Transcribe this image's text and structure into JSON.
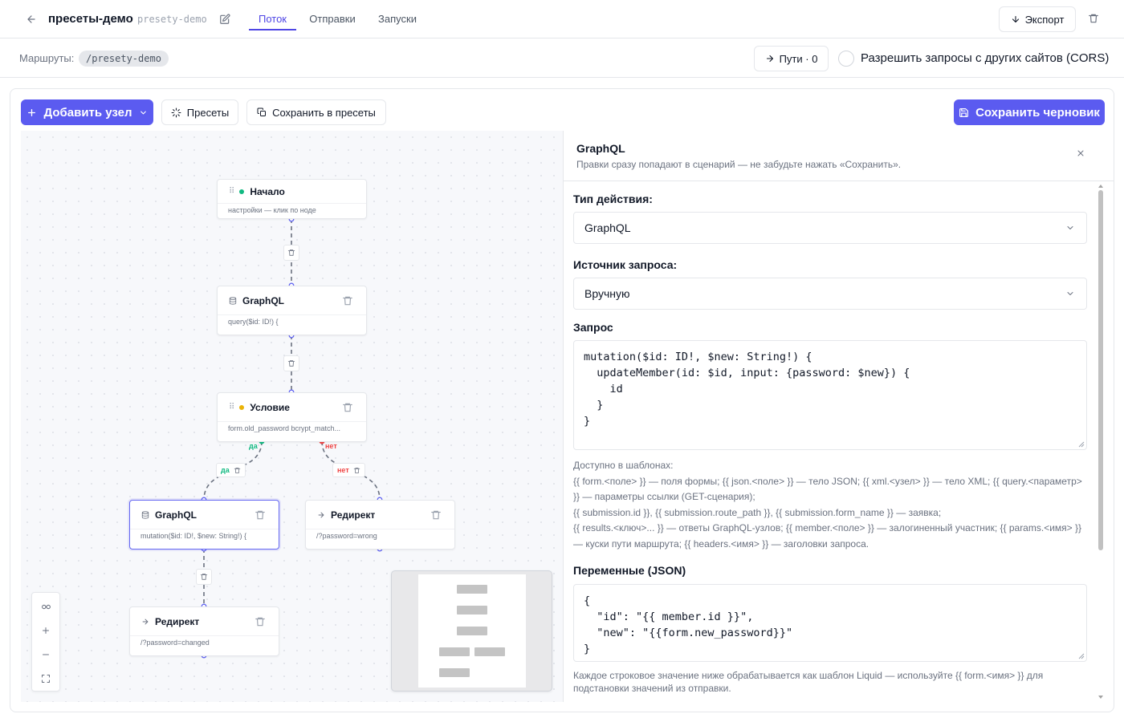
{
  "header": {
    "title": "пресеты-демо",
    "slug": "presety-demo",
    "tabs": [
      {
        "label": "Поток",
        "active": true
      },
      {
        "label": "Отправки",
        "active": false
      },
      {
        "label": "Запуски",
        "active": false
      }
    ],
    "export_label": "Экспорт"
  },
  "routes": {
    "label": "Маршруты:",
    "route": "/presety-demo",
    "paths_label": "Пути · 0",
    "cors_label": "Разрешить запросы с других сайтов (CORS)",
    "cors_checked": false
  },
  "toolbar": {
    "add_node_label": "Добавить узел",
    "presets_label": "Пресеты",
    "save_preset_label": "Сохранить в пресеты",
    "save_draft_label": "Сохранить черновик"
  },
  "flow": {
    "nodes": [
      {
        "title": "Начало",
        "subtitle": "настройки — клик по ноде",
        "status_color": "#10b981"
      },
      {
        "title": "GraphQL",
        "subtitle": "query($id: ID!) {"
      },
      {
        "title": "Условие",
        "subtitle": "form.old_password bcrypt_match...",
        "status_color": "#eab308"
      },
      {
        "title": "GraphQL",
        "subtitle": "mutation($id: ID!, $new: String!) {",
        "selected": true
      },
      {
        "title": "Редирект",
        "subtitle": "/?password=wrong"
      },
      {
        "title": "Редирект",
        "subtitle": "/?password=changed"
      }
    ],
    "edge_labels": {
      "yes": "да",
      "no": "нет"
    }
  },
  "panel": {
    "title": "GraphQL",
    "subtitle": "Правки сразу попадают в сценарий — не забудьте нажать «Сохранить».",
    "action_type_label": "Тип действия:",
    "action_type_value": "GraphQL",
    "source_label": "Источник запроса:",
    "source_value": "Вручную",
    "query_label": "Запрос",
    "query_value": "mutation($id: ID!, $new: String!) {\n  updateMember(id: $id, input: {password: $new}) {\n    id\n  }\n}",
    "templates_title": "Доступно в шаблонах:",
    "templates_line1": "{{ form.<поле> }} — поля формы; {{ json.<поле> }} — тело JSON; {{ xml.<узел> }} — тело XML; {{ query.<параметр> }} — параметры ссылки (GET-сценария);",
    "templates_line2": "{{ submission.id }}, {{ submission.route_path }}, {{ submission.form_name }} — заявка;",
    "templates_line3": "{{ results.<ключ>... }} — ответы GraphQL-узлов; {{ member.<поле> }} — залогиненный участник; {{ params.<имя> }} — куски пути маршрута; {{ headers.<имя> }} — заголовки запроса.",
    "variables_label": "Переменные (JSON)",
    "variables_value": "{\n  \"id\": \"{{ member.id }}\",\n  \"new\": \"{{form.new_password}}\"\n}",
    "variables_hint": "Каждое строковое значение ниже обрабатывается как шаблон Liquid — используйте {{ form.<имя> }} для подстановки значений из отправки."
  },
  "colors": {
    "accent": "#5b5bf0",
    "success": "#10b981",
    "warning": "#eab308",
    "danger": "#ef4444"
  }
}
